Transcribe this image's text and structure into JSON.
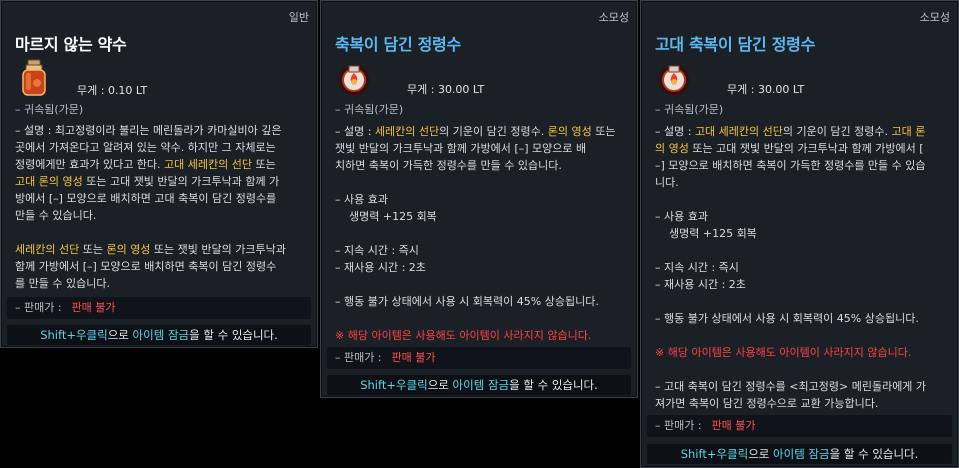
{
  "panels": [
    {
      "type": "일반",
      "title": "마르지 않는 약수",
      "weight": "무게 :   0.10 LT",
      "bound": "– 귀속됨(가문)",
      "desc": [
        [
          {
            "t": "– 설명 : 최고정령이라 불리는 메린돌라가 카마실비아 깊은"
          }
        ],
        [
          {
            "t": "곳에서 가져온다고 알려져 있는 약수. 하지만 그 자체로는"
          }
        ],
        [
          {
            "t": "정령에게만 효과가 있다고 한다. "
          },
          {
            "t": "고대 세레칸의 선단",
            "c": "hl"
          },
          {
            "t": " 또는"
          }
        ],
        [
          {
            "t": "고대 론의 영성",
            "c": "hl"
          },
          {
            "t": " 또는 고대 잿빛 반달의 가크투낙과 함께 가"
          }
        ],
        [
          {
            "t": "방에서 [–] 모양으로 배치하면 고대 축복이 담긴 정령수를"
          }
        ],
        [
          {
            "t": "만들 수 있습니다."
          }
        ],
        [
          {
            "t": ""
          }
        ],
        [
          {
            "t": "세레칸의 선단",
            "c": "hl"
          },
          {
            "t": " 또는 "
          },
          {
            "t": "론의 영성",
            "c": "hl"
          },
          {
            "t": " 또는 잿빛 반달의 가크투낙과"
          }
        ],
        [
          {
            "t": " 함께 가방에서 [–] 모양으로 배치하면 축복이 담긴 정령수"
          }
        ],
        [
          {
            "t": "를 만들 수 있습니다."
          }
        ]
      ],
      "sale_label": "– 판매가 :",
      "sale_value": "판매 불가",
      "shift_parts": [
        {
          "t": "Shift+우클릭",
          "c": "cyan"
        },
        {
          "t": "으로 "
        },
        {
          "t": "아이템 잠금",
          "c": "cyan"
        },
        {
          "t": "을 할 수 있습니다."
        }
      ]
    },
    {
      "type": "소모성",
      "title": "축복이 담긴 정령수",
      "weight": "무게 :   30.00 LT",
      "bound": "– 귀속됨(가문)",
      "desc": [
        [
          {
            "t": "– 설명 : "
          },
          {
            "t": "세레칸의 선단",
            "c": "hl"
          },
          {
            "t": "의 기운이 담긴 정령수. "
          },
          {
            "t": "론의 영성",
            "c": "hl"
          },
          {
            "t": " 또는"
          }
        ],
        [
          {
            "t": "잿빛 반달의 가크투낙과 함께 가방에서 [–] 모양으로 배"
          }
        ],
        [
          {
            "t": "치하면 축복이 가득한 정령수를 만들 수 있습니다."
          }
        ],
        [
          {
            "t": ""
          }
        ],
        [
          {
            "t": "– 사용 효과"
          }
        ],
        [
          {
            "t": "생명력 +125 회복",
            "c": "effect"
          }
        ],
        [
          {
            "t": ""
          }
        ],
        [
          {
            "t": "– 지속 시간 : 즉시"
          }
        ],
        [
          {
            "t": "– 재사용 시간 : 2초"
          }
        ],
        [
          {
            "t": ""
          }
        ],
        [
          {
            "t": "– 행동 불가 상태에서 사용 시 회복력이 45% 상승됩니다."
          }
        ],
        [
          {
            "t": ""
          }
        ],
        [
          {
            "t": "※ 해당 아이템은 사용해도 아이템이 사라지지 않습니다.",
            "c": "red"
          }
        ]
      ],
      "sale_label": "– 판매가 :",
      "sale_value": "판매 불가",
      "shift_parts": [
        {
          "t": "Shift+우클릭",
          "c": "cyan"
        },
        {
          "t": "으로 "
        },
        {
          "t": "아이템 잠금",
          "c": "cyan"
        },
        {
          "t": "을 할 수 있습니다."
        }
      ]
    },
    {
      "type": "소모성",
      "title": "고대 축복이 담긴 정령수",
      "weight": "무게 :   30.00 LT",
      "bound": "– 귀속됨(가문)",
      "desc": [
        [
          {
            "t": "– 설명 : "
          },
          {
            "t": "고대 세레칸의 선단",
            "c": "hl"
          },
          {
            "t": "의 기운이 담긴 정령수. "
          },
          {
            "t": "고대 론",
            "c": "hl"
          }
        ],
        [
          {
            "t": "의 영성",
            "c": "hl"
          },
          {
            "t": " 또는 고대 잿빛 반달의 가크투낙과 함께 가방에서 ["
          }
        ],
        [
          {
            "t": "–] 모양으로 배치하면 축복이 가득한 정령수를 만들 수 있습"
          }
        ],
        [
          {
            "t": "니다."
          }
        ],
        [
          {
            "t": ""
          }
        ],
        [
          {
            "t": "– 사용 효과"
          }
        ],
        [
          {
            "t": "생명력 +125 회복",
            "c": "effect"
          }
        ],
        [
          {
            "t": ""
          }
        ],
        [
          {
            "t": "– 지속 시간 : 즉시"
          }
        ],
        [
          {
            "t": "– 재사용 시간 : 2초"
          }
        ],
        [
          {
            "t": ""
          }
        ],
        [
          {
            "t": "– 행동 불가 상태에서 사용 시 회복력이 45% 상승됩니다."
          }
        ],
        [
          {
            "t": ""
          }
        ],
        [
          {
            "t": "※ 해당 아이템은 사용해도 아이템이 사라지지 않습니다.",
            "c": "red"
          }
        ],
        [
          {
            "t": ""
          }
        ],
        [
          {
            "t": "– 고대 축복이 담긴 정령수를 <최고정령> 메린돌라에게 가"
          }
        ],
        [
          {
            "t": "져가면 축복이 담긴 정령수으로 교환 가능합니다."
          }
        ]
      ],
      "sale_label": "– 판매가 :",
      "sale_value": "판매 불가",
      "shift_parts": [
        {
          "t": "Shift+우클릭",
          "c": "cyan"
        },
        {
          "t": "으로 "
        },
        {
          "t": "아이템 잠금",
          "c": "cyan"
        },
        {
          "t": "을 할 수 있습니다."
        }
      ]
    }
  ]
}
